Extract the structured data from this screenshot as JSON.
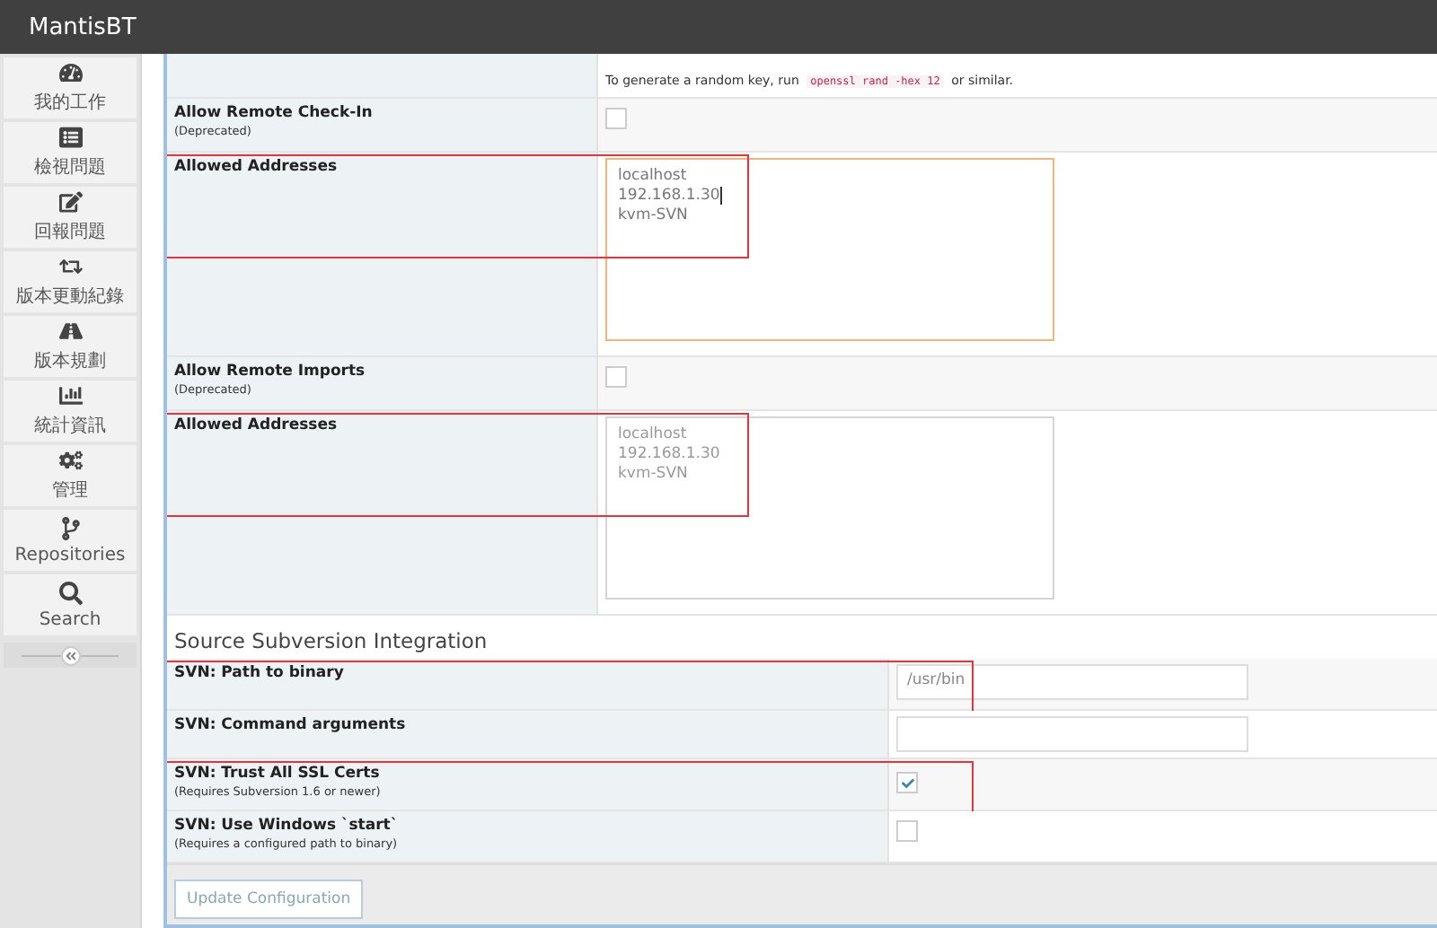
{
  "window": {
    "title": "MantisBT"
  },
  "sidebar": {
    "items": [
      {
        "label": "我的工作",
        "selected": false
      },
      {
        "label": "檢視問題",
        "selected": false
      },
      {
        "label": "回報問題",
        "selected": false
      },
      {
        "label": "版本更動紀錄",
        "selected": false
      },
      {
        "label": "版本規劃",
        "selected": false
      },
      {
        "label": "統計資訊",
        "selected": false
      },
      {
        "label": "管理",
        "selected": false
      },
      {
        "label": "Repositories",
        "selected": false
      },
      {
        "label": "Search",
        "selected": false
      }
    ]
  },
  "remote_section": {
    "note": {
      "before": "To generate a random key, run",
      "code": "openssl rand -hex 12",
      "after": "or similar."
    },
    "rows": [
      {
        "kind": "checkbox",
        "label": "Allow Remote Check-In",
        "hint": "(Deprecated)",
        "checked": false,
        "annotated": false
      },
      {
        "kind": "textarea",
        "label": "Allowed Addresses",
        "lines": [
          "localhost",
          "192.168.1.30",
          "kvm-SVN"
        ],
        "focused": true,
        "disabled": false,
        "annotated": true
      },
      {
        "kind": "checkbox",
        "label": "Allow Remote Imports",
        "hint": "(Deprecated)",
        "checked": false,
        "annotated": false
      },
      {
        "kind": "textarea",
        "label": "Allowed Addresses",
        "lines": [
          "localhost",
          "192.168.1.30",
          "kvm-SVN"
        ],
        "focused": false,
        "disabled": true,
        "annotated": true
      }
    ]
  },
  "svn_section": {
    "title": "Source Subversion Integration",
    "rows": [
      {
        "kind": "text",
        "label": "SVN: Path to binary",
        "value": "/usr/bin",
        "annotated": true
      },
      {
        "kind": "text",
        "label": "SVN: Command arguments",
        "annotated": false
      },
      {
        "kind": "checkbox",
        "label": "SVN: Trust All SSL Certs",
        "hint": "(Requires Subversion 1.6 or newer)",
        "checked": true,
        "annotated": true
      },
      {
        "kind": "checkbox",
        "label": "SVN: Use Windows `start`",
        "hint": "(Requires a configured path to binary)",
        "checked": false,
        "annotated": false
      }
    ]
  },
  "buttons": [
    "Update Configuration"
  ]
}
